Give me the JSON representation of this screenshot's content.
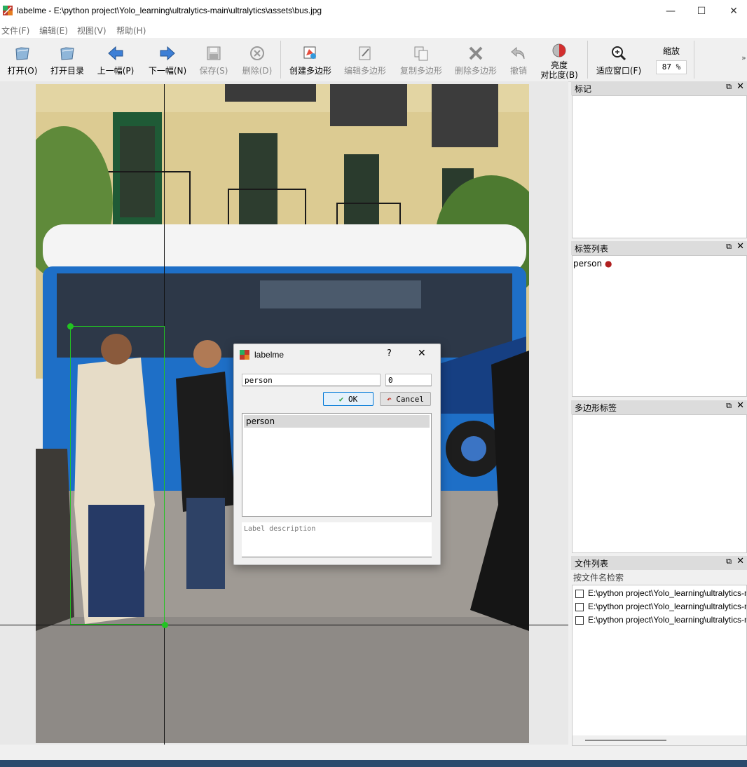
{
  "window": {
    "title": "labelme - E:\\python project\\Yolo_learning\\ultralytics-main\\ultralytics\\assets\\bus.jpg",
    "minimize": "—",
    "maximize": "☐",
    "close": "✕"
  },
  "menu": [
    "文件(F)",
    "编辑(E)",
    "视图(V)",
    "帮助(H)"
  ],
  "toolbar": {
    "open": "打开(O)",
    "open_dir": "打开目录",
    "prev": "上一幅(P)",
    "next": "下一幅(N)",
    "save": "保存(S)",
    "delete": "删除(D)",
    "create_polygon": "创建多边形",
    "edit_polygon": "编辑多边形",
    "copy_polygon": "复制多边形",
    "delete_polygon": "删除多边形",
    "undo": "撤销",
    "brightness_line1": "亮度",
    "brightness_line2": "对比度(B)",
    "fit_window": "适应窗口(F)",
    "zoom_label": "缩放",
    "zoom_value": "87 %",
    "more": "»"
  },
  "docks": {
    "flags": {
      "title": "标记"
    },
    "labels": {
      "title": "标签列表",
      "items": [
        "person"
      ]
    },
    "polygons": {
      "title": "多边形标签"
    },
    "files": {
      "title": "文件列表",
      "search_placeholder": "按文件名检索",
      "items": [
        "E:\\python project\\Yolo_learning\\ultralytics-main",
        "E:\\python project\\Yolo_learning\\ultralytics-main",
        "E:\\python project\\Yolo_learning\\ultralytics-main"
      ]
    },
    "float_icon": "⧉",
    "close_icon": "✕"
  },
  "dialog": {
    "title": "labelme",
    "help": "?",
    "close": "✕",
    "label_value": "person",
    "group_value": "0",
    "ok": "OK",
    "cancel": "Cancel",
    "list": [
      "person"
    ],
    "description_placeholder": "Label description"
  },
  "colors": {
    "bbox": "#22c322",
    "label_dot": "#b02020",
    "accent": "#0078d7"
  }
}
